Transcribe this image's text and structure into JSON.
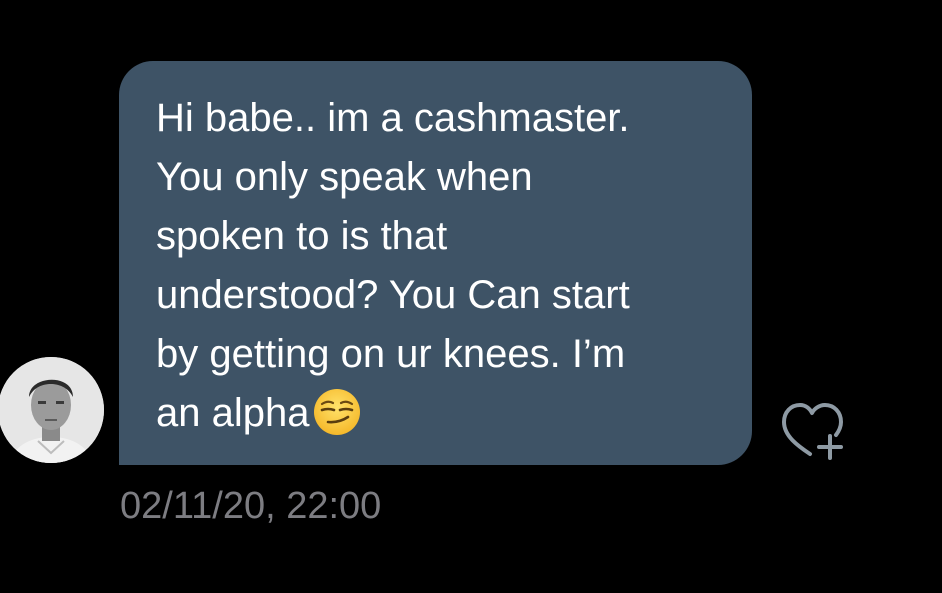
{
  "message": {
    "lines": [
      "Hi babe.. im a cashmaster.",
      "You only speak when",
      "spoken to is that",
      "understood? You Can start",
      "by getting on ur knees. I’m",
      "an alpha"
    ],
    "trailing_emoji": "smirking-face-emoji",
    "timestamp": "02/11/20, 22:00"
  },
  "avatar": {
    "icon": "profile-photo"
  },
  "actions": {
    "react_icon": "heart-plus-icon"
  },
  "colors": {
    "background": "#000000",
    "bubble": "#3e5366",
    "message_text": "#ffffff",
    "timestamp_text": "#7d7d82",
    "icon_stroke": "#8e9aa4"
  }
}
